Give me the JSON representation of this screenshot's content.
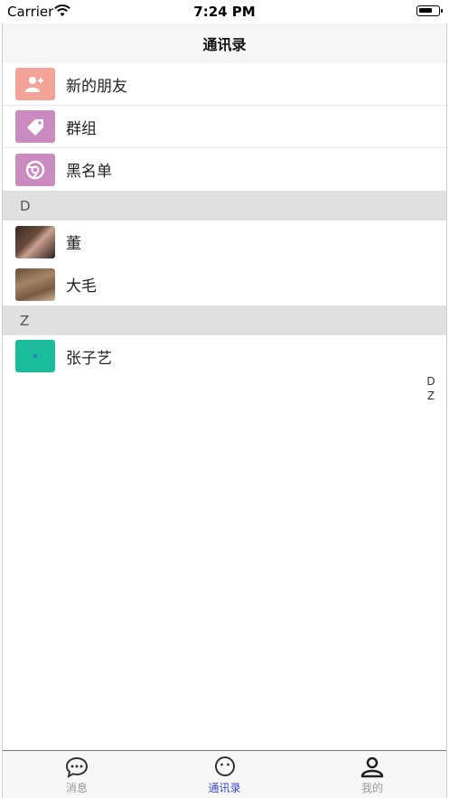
{
  "status_bar": {
    "carrier": "Carrier",
    "time": "7:24 PM"
  },
  "nav": {
    "title": "通讯录"
  },
  "function_items": [
    {
      "label": "新的朋友",
      "icon": "add-friend-icon",
      "color": "#f4a497"
    },
    {
      "label": "群组",
      "icon": "tag-icon",
      "color": "#c98bc0"
    },
    {
      "label": "黑名单",
      "icon": "blacklist-icon",
      "color": "#c98bc0"
    }
  ],
  "sections": [
    {
      "letter": "D",
      "contacts": [
        {
          "name": "董"
        },
        {
          "name": "大毛"
        }
      ]
    },
    {
      "letter": "Z",
      "contacts": [
        {
          "name": "张子艺"
        }
      ]
    }
  ],
  "index_letters": [
    "D",
    "Z"
  ],
  "tabs": [
    {
      "label": "消息",
      "icon": "chat-bubble-icon",
      "active": false
    },
    {
      "label": "通讯录",
      "icon": "contacts-smile-icon",
      "active": true
    },
    {
      "label": "我的",
      "icon": "person-icon",
      "active": false
    }
  ],
  "colors": {
    "active_tab": "#3a45c7",
    "section_bg": "#e0e0e0",
    "teal_avatar": "#1abc9c"
  }
}
